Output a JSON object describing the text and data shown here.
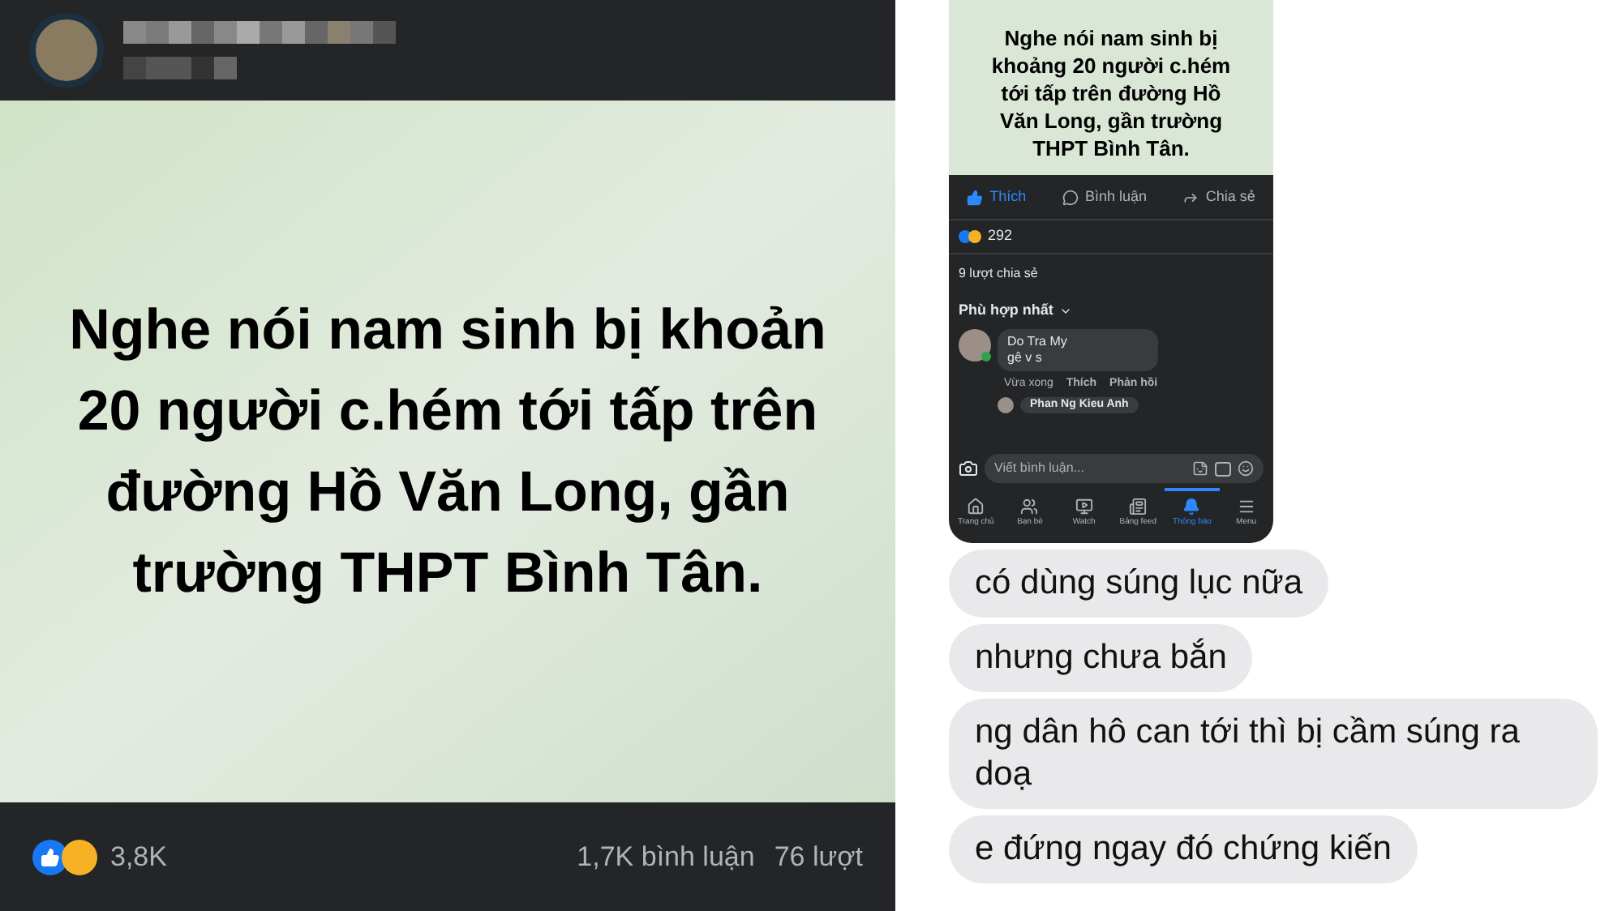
{
  "facebook_post": {
    "image_text_lines": [
      "Nghe nói nam sinh bị khoản",
      "20 người c.hém tới tấp trên",
      "đường Hồ Văn Long, gần",
      "trường THPT Bình Tân."
    ],
    "reactions_count": "3,8K",
    "comments_count": "1,7K bình luận",
    "shares_count": "76 lượt"
  },
  "phone_screenshot": {
    "post_text_lines": [
      "Nghe nói nam sinh bị",
      "khoảng 20 người c.hém",
      "tới tấp trên đường Hồ",
      "Văn Long, gần trường",
      "THPT Bình Tân."
    ],
    "actions": [
      {
        "kind": "like",
        "label": "Thích",
        "selected": true
      },
      {
        "kind": "comment",
        "label": "Bình luận",
        "selected": false
      },
      {
        "kind": "share",
        "label": "Chia sẻ",
        "selected": false
      }
    ],
    "reactions_count": "292",
    "shares": "9 lượt chia sẻ",
    "sort": "Phù hợp nhất",
    "comments": [
      {
        "author": "Do Tra My",
        "text": "gê v s",
        "online": true,
        "time": "Vừa xong",
        "actions": [
          "Thích",
          "Phản hồi"
        ]
      }
    ],
    "next_comment_author": "Phan Ng Kieu Anh",
    "comment_placeholder": "Viết bình luận...",
    "nav": [
      {
        "kind": "home",
        "label": "Trang chủ",
        "selected": false
      },
      {
        "kind": "friends",
        "label": "Bạn bè",
        "selected": false
      },
      {
        "kind": "watch",
        "label": "Watch",
        "selected": false
      },
      {
        "kind": "feeds",
        "label": "Bảng feed",
        "selected": false
      },
      {
        "kind": "notifications",
        "label": "Thông báo",
        "selected": true
      },
      {
        "kind": "menu",
        "label": "Menu",
        "selected": false
      }
    ]
  },
  "messages": [
    {
      "text": "có dùng súng lục nữa"
    },
    {
      "text": "nhưng chưa bắn"
    },
    {
      "text": "ng dân hô can tới thì bị cầm súng ra doạ"
    },
    {
      "text": "e đứng ngay đó chứng kiến"
    }
  ]
}
